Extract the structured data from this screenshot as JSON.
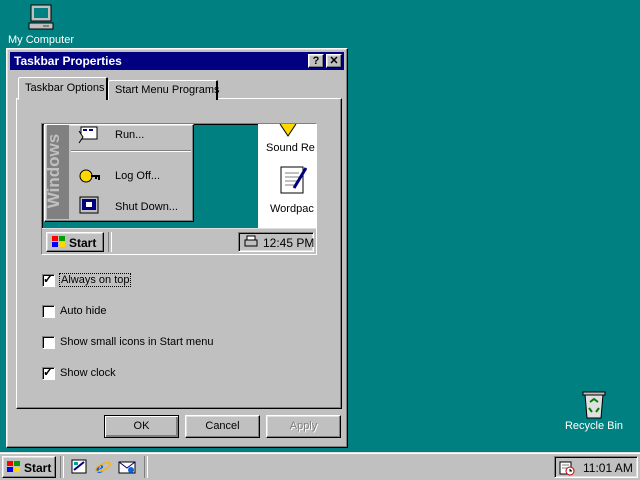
{
  "desktop": {
    "icons": [
      {
        "label": "My Computer",
        "icon": "my-computer-icon"
      },
      {
        "label": "Recycle Bin",
        "icon": "recycle-bin-icon"
      }
    ]
  },
  "window": {
    "title": "Taskbar Properties",
    "help_btn": "?",
    "close_btn": "✕",
    "tabs": [
      {
        "label": "Taskbar Options",
        "active": true
      },
      {
        "label": "Start Menu Programs",
        "active": false
      }
    ],
    "preview": {
      "banner": "Windows",
      "menu_items": [
        {
          "label": "Run...",
          "icon": "run-icon"
        },
        {
          "label": "Log Off...",
          "icon": "log-off-icon"
        },
        {
          "label": "Shut Down...",
          "icon": "shut-down-icon"
        }
      ],
      "desktop_items": [
        {
          "label": "Sound Re",
          "icon": "sound-recorder-icon"
        },
        {
          "label": "Wordpac",
          "icon": "wordpad-icon"
        }
      ],
      "start_label": "Start",
      "clock": "12:45 PM"
    },
    "options": [
      {
        "label": "Always on top",
        "checked": true
      },
      {
        "label": "Auto hide",
        "checked": false
      },
      {
        "label": "Show small icons in Start menu",
        "checked": false
      },
      {
        "label": "Show clock",
        "checked": true
      }
    ],
    "buttons": {
      "ok": "OK",
      "cancel": "Cancel",
      "apply": "Apply"
    }
  },
  "taskbar": {
    "start_label": "Start",
    "quick_launch": [
      "desktop-icon",
      "internet-explorer-icon",
      "outlook-express-icon"
    ],
    "clock": "11:01 AM"
  }
}
